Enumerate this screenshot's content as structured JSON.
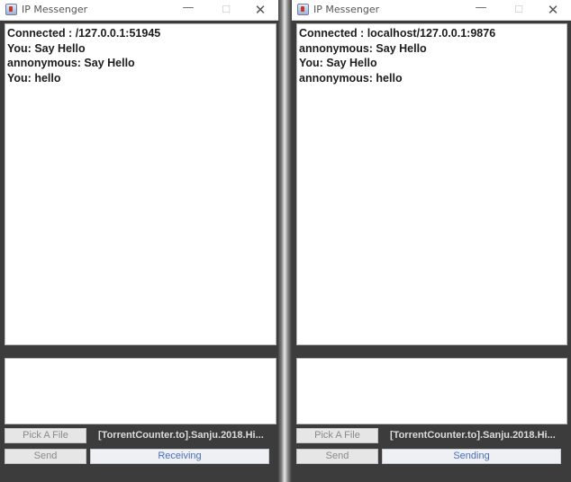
{
  "windows": [
    {
      "title": "IP Messenger",
      "messages": [
        "Connected : /127.0.0.1:51945",
        "You: Say Hello",
        "annonymous: Say Hello",
        "You: hello"
      ],
      "pick_button": "Pick A File",
      "file_name": "[TorrentCounter.to].Sanju.2018.Hi...",
      "send_button": "Send",
      "status": "Receiving"
    },
    {
      "title": "IP Messenger",
      "messages": [
        "Connected : localhost/127.0.0.1:9876",
        "annonymous: Say Hello",
        "You: Say Hello",
        "annonymous: hello"
      ],
      "pick_button": "Pick A File",
      "file_name": "[TorrentCounter.to].Sanju.2018.Hi...",
      "send_button": "Send",
      "status": "Sending"
    }
  ],
  "window_controls": {
    "minimize": "—",
    "maximize": "☐",
    "close": "✕"
  },
  "colors": {
    "window_background": "#3c3c3c",
    "status_text": "#4a6fb8"
  }
}
